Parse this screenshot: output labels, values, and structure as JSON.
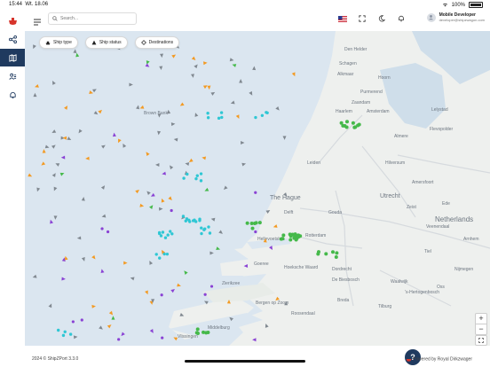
{
  "status_bar": {
    "time": "15:44",
    "date": "Wt. 18.06",
    "battery": "100%"
  },
  "search": {
    "placeholder": "Search..."
  },
  "user": {
    "name": "Mobile Developer",
    "email": "developer@shipzwagon.com"
  },
  "filters": [
    {
      "label": "Ship type",
      "icon": "ship-icon"
    },
    {
      "label": "Ship status",
      "icon": "warning-icon"
    },
    {
      "label": "Destinations",
      "icon": "destination-icon"
    }
  ],
  "sidebar": [
    {
      "name": "share",
      "icon": "share-nodes-icon"
    },
    {
      "name": "map",
      "icon": "map-icon",
      "active": true
    },
    {
      "name": "users",
      "icon": "users-icon"
    },
    {
      "name": "notifications",
      "icon": "bell-icon"
    }
  ],
  "map": {
    "labels": {
      "the_hague": "The Hague",
      "utrecht": "Utrecht",
      "netherlands": "Netherlands",
      "haarlem": "Haarlem",
      "amsterdam": "Amsterdam",
      "purmerend": "Purmerend",
      "leiden": "Leiden",
      "delft": "Delft",
      "gouda": "Gouda",
      "rotterdam": "Rotterdam",
      "dordrecht": "Dordrecht",
      "breda": "Breda",
      "hilversum": "Hilversum",
      "almere": "Almere",
      "amersfoort": "Amersfoort",
      "alkmaar": "Alkmaar",
      "ede": "Ede",
      "tilburg": "Tilburg",
      "nijmegen": "Nijmegen",
      "arnhem": "Arnhem",
      "den_helder": "Den Helder",
      "lelystad": "Lelystad",
      "middelburg": "Middelburg",
      "roosendaal": "Roosendaal",
      "hoorn": "Hoorn",
      "zaandam": "Zaandam",
      "hellevoetsluis": "Hellevoetsluis",
      "zierikzee": "Zierikzee",
      "vlissingen": "Vlissingen",
      "zeist": "Zeist",
      "veenendaal": "Veenendaal",
      "brown_bank": "Brown Bank",
      "goeree": "Goeree",
      "hoeksche_waard": "Hoeksche Waard",
      "bergen_op_zoom": "Bergen op Zoom",
      "schagen": "Schagen",
      "lelystad_airport": "Flevopolder",
      "tiel": "Tiel",
      "waalwijk": "Waalwijk",
      "oss": "Oss",
      "den_bosch": "'s-Hertogenbosch",
      "de_biesbosch": "De Biesbosch"
    }
  },
  "footer": {
    "copyright": "2024 © ShipZPort 3.3.0",
    "powered": "Powered by Royal Dirkzwager"
  },
  "colors": {
    "primary": "#1f3a5f",
    "sea": "#dbe6f0",
    "land": "#eef0ee",
    "cargo": "#2fc7d4",
    "tanker": "#f39a22",
    "other": "#808890",
    "pleasure": "#8a42d4",
    "green": "#45b94a"
  }
}
